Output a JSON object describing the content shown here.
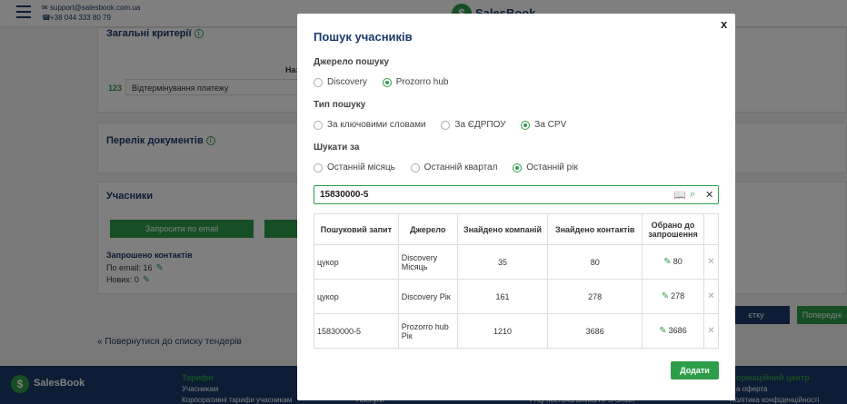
{
  "header": {
    "email": "support@salesbook.com.ua",
    "phone": "+38 044 333 80 79",
    "logo_text": "SalesBook"
  },
  "background": {
    "general_criteria_title": "Загальні критерії",
    "col_header_partial": "Наз",
    "row_code": "123",
    "row_label": "Відтермінування платежу",
    "documents_title": "Перелік документів",
    "participants_title": "Учасники",
    "request_email_btn": "Запросити по email",
    "invited_title": "Запрошено контактів",
    "by_email": "По email: 16",
    "new_count": "Новиx: 0",
    "back_link": "Повернутися до списку тендерів",
    "right_btn_1": "єтку",
    "right_btn_2": "Попередні",
    "footer_logo": "SalesBook",
    "footer_col_tariffs": "Тарифи",
    "footer_item_participants": "Учасникам",
    "footer_item_corp": "Корпоративні тарифи учасникам",
    "footer_item_services": "Послуги",
    "footer_item_faq": "FAQ постачальника APS Smart",
    "footer_col_info": "ормаційний центр",
    "footer_item_offer": "а оферта",
    "footer_item_privacy": "Політика конфіденційності"
  },
  "modal": {
    "title": "Пошук учасників",
    "close": "x",
    "source_label": "Джерело пошуку",
    "source_options": [
      "Discovery",
      "Prozorro hub"
    ],
    "type_label": "Тип пошуку",
    "type_options": [
      "За ключовими словами",
      "За ЄДРПОУ",
      "За CPV"
    ],
    "period_label": "Шукати за",
    "period_options": [
      "Останній місяць",
      "Останній квартал",
      "Останній рік"
    ],
    "search_value": "15830000-5",
    "table": {
      "headers": [
        "Пошуковий запит",
        "Джерело",
        "Знайдено компаній",
        "Знайдено контактів",
        "Обрано до запрошення"
      ],
      "rows": [
        {
          "query": "цукор",
          "source": "Discovery Місяць",
          "companies": "35",
          "contacts": "80",
          "selected": "80"
        },
        {
          "query": "цукор",
          "source": "Discovery Рік",
          "companies": "161",
          "contacts": "278",
          "selected": "278"
        },
        {
          "query": "15830000-5",
          "source": "Prozorro hub Рік",
          "companies": "1210",
          "contacts": "3686",
          "selected": "3686"
        }
      ]
    },
    "add_button": "Додати"
  }
}
